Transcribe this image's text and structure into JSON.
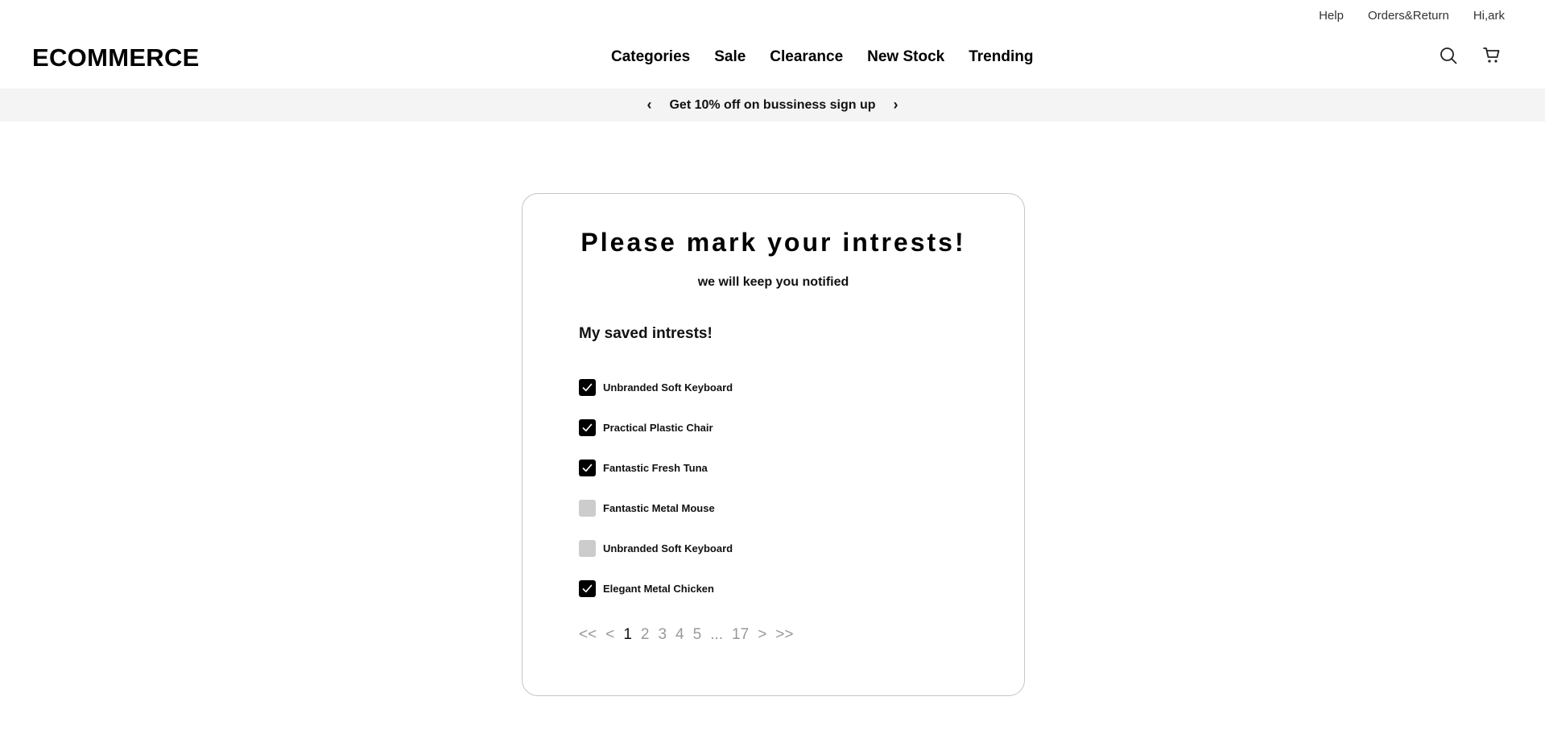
{
  "top_links": [
    "Help",
    "Orders&Return",
    "Hi,ark"
  ],
  "brand": "ECOMMERCE",
  "nav": [
    "Categories",
    "Sale",
    "Clearance",
    "New Stock",
    "Trending"
  ],
  "header_icons": [
    "search-icon",
    "cart-icon"
  ],
  "promo": {
    "prev": "‹",
    "text": "Get 10% off on bussiness sign up",
    "next": "›"
  },
  "card": {
    "title": "Please mark your intrests!",
    "subtitle": "we will keep you notified",
    "list_title": "My saved intrests!",
    "items": [
      {
        "label": "Unbranded Soft Keyboard",
        "checked": true
      },
      {
        "label": "Practical Plastic Chair",
        "checked": true
      },
      {
        "label": "Fantastic Fresh Tuna",
        "checked": true
      },
      {
        "label": "Fantastic Metal Mouse",
        "checked": false
      },
      {
        "label": "Unbranded Soft Keyboard",
        "checked": false
      },
      {
        "label": "Elegant Metal Chicken",
        "checked": true
      }
    ]
  },
  "pagination": {
    "first": "<<",
    "prev": "<",
    "pages": [
      "1",
      "2",
      "3",
      "4",
      "5"
    ],
    "ellipsis": "...",
    "last_page": "17",
    "next": ">",
    "last": ">>",
    "current": "1"
  },
  "colors": {
    "checked_box": "#000000",
    "unchecked_box": "#cccccc",
    "promo_bg": "#f4f4f4",
    "pager_inactive": "#999999"
  }
}
